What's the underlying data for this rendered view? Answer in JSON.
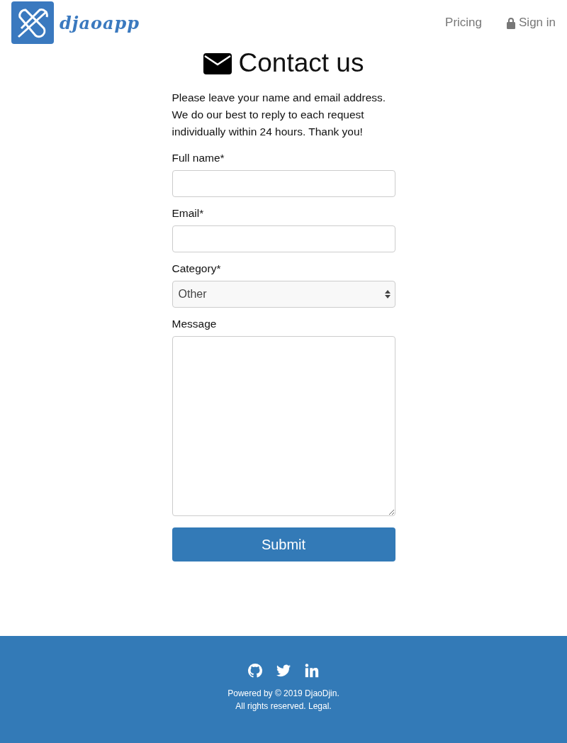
{
  "header": {
    "logo_text": "djaoapp",
    "nav": [
      {
        "label": "Pricing",
        "kind": "link"
      },
      {
        "label": "Sign in",
        "kind": "lock"
      }
    ]
  },
  "title": "Contact us",
  "intro": "Please leave your name and email address. We do our best to reply to each request individually within 24 hours. Thank you!",
  "form": {
    "fields": [
      {
        "label": "Full name*",
        "kind": "text"
      },
      {
        "label": "Email*",
        "kind": "text"
      },
      {
        "label": "Category*",
        "kind": "select",
        "value": "Other"
      },
      {
        "label": "Message",
        "kind": "textarea"
      }
    ],
    "submit": "Submit"
  },
  "footer": {
    "lines": [
      "Powered by © 2019 DjaoDjin.",
      "All rights reserved. Legal."
    ]
  }
}
